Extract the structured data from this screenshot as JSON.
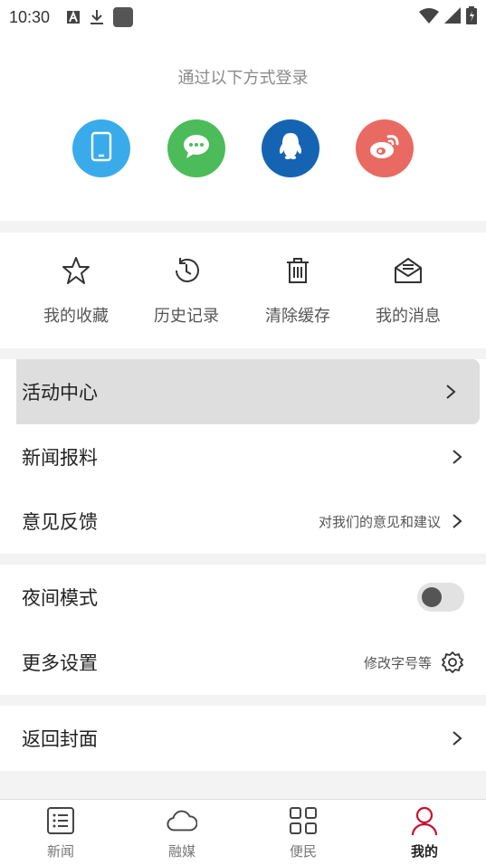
{
  "status_bar": {
    "time": "10:30"
  },
  "login": {
    "title": "通过以下方式登录",
    "methods": [
      {
        "name": "phone-icon",
        "color": "#3aabea"
      },
      {
        "name": "wechat-icon",
        "color": "#4cbb5a"
      },
      {
        "name": "qq-icon",
        "color": "#1564b3"
      },
      {
        "name": "weibo-icon",
        "color": "#e86a63"
      }
    ]
  },
  "quick_actions": [
    {
      "label": "我的收藏",
      "icon": "star-icon"
    },
    {
      "label": "历史记录",
      "icon": "history-icon"
    },
    {
      "label": "清除缓存",
      "icon": "trash-icon"
    },
    {
      "label": "我的消息",
      "icon": "mail-icon"
    }
  ],
  "menu": {
    "activity_center": "活动中心",
    "news_tip": "新闻报料",
    "feedback": {
      "label": "意见反馈",
      "hint": "对我们的意见和建议"
    },
    "night_mode": {
      "label": "夜间模式",
      "enabled": false
    },
    "more_settings": {
      "label": "更多设置",
      "hint": "修改字号等"
    },
    "return_cover": "返回封面"
  },
  "tabs": [
    {
      "label": "新闻",
      "icon": "news-list-icon",
      "active": false
    },
    {
      "label": "融媒",
      "icon": "cloud-icon",
      "active": false
    },
    {
      "label": "便民",
      "icon": "grid-icon",
      "active": false
    },
    {
      "label": "我的",
      "icon": "user-icon",
      "active": true
    }
  ],
  "colors": {
    "accent": "#c8102e",
    "highlight_bg": "#dedede"
  }
}
